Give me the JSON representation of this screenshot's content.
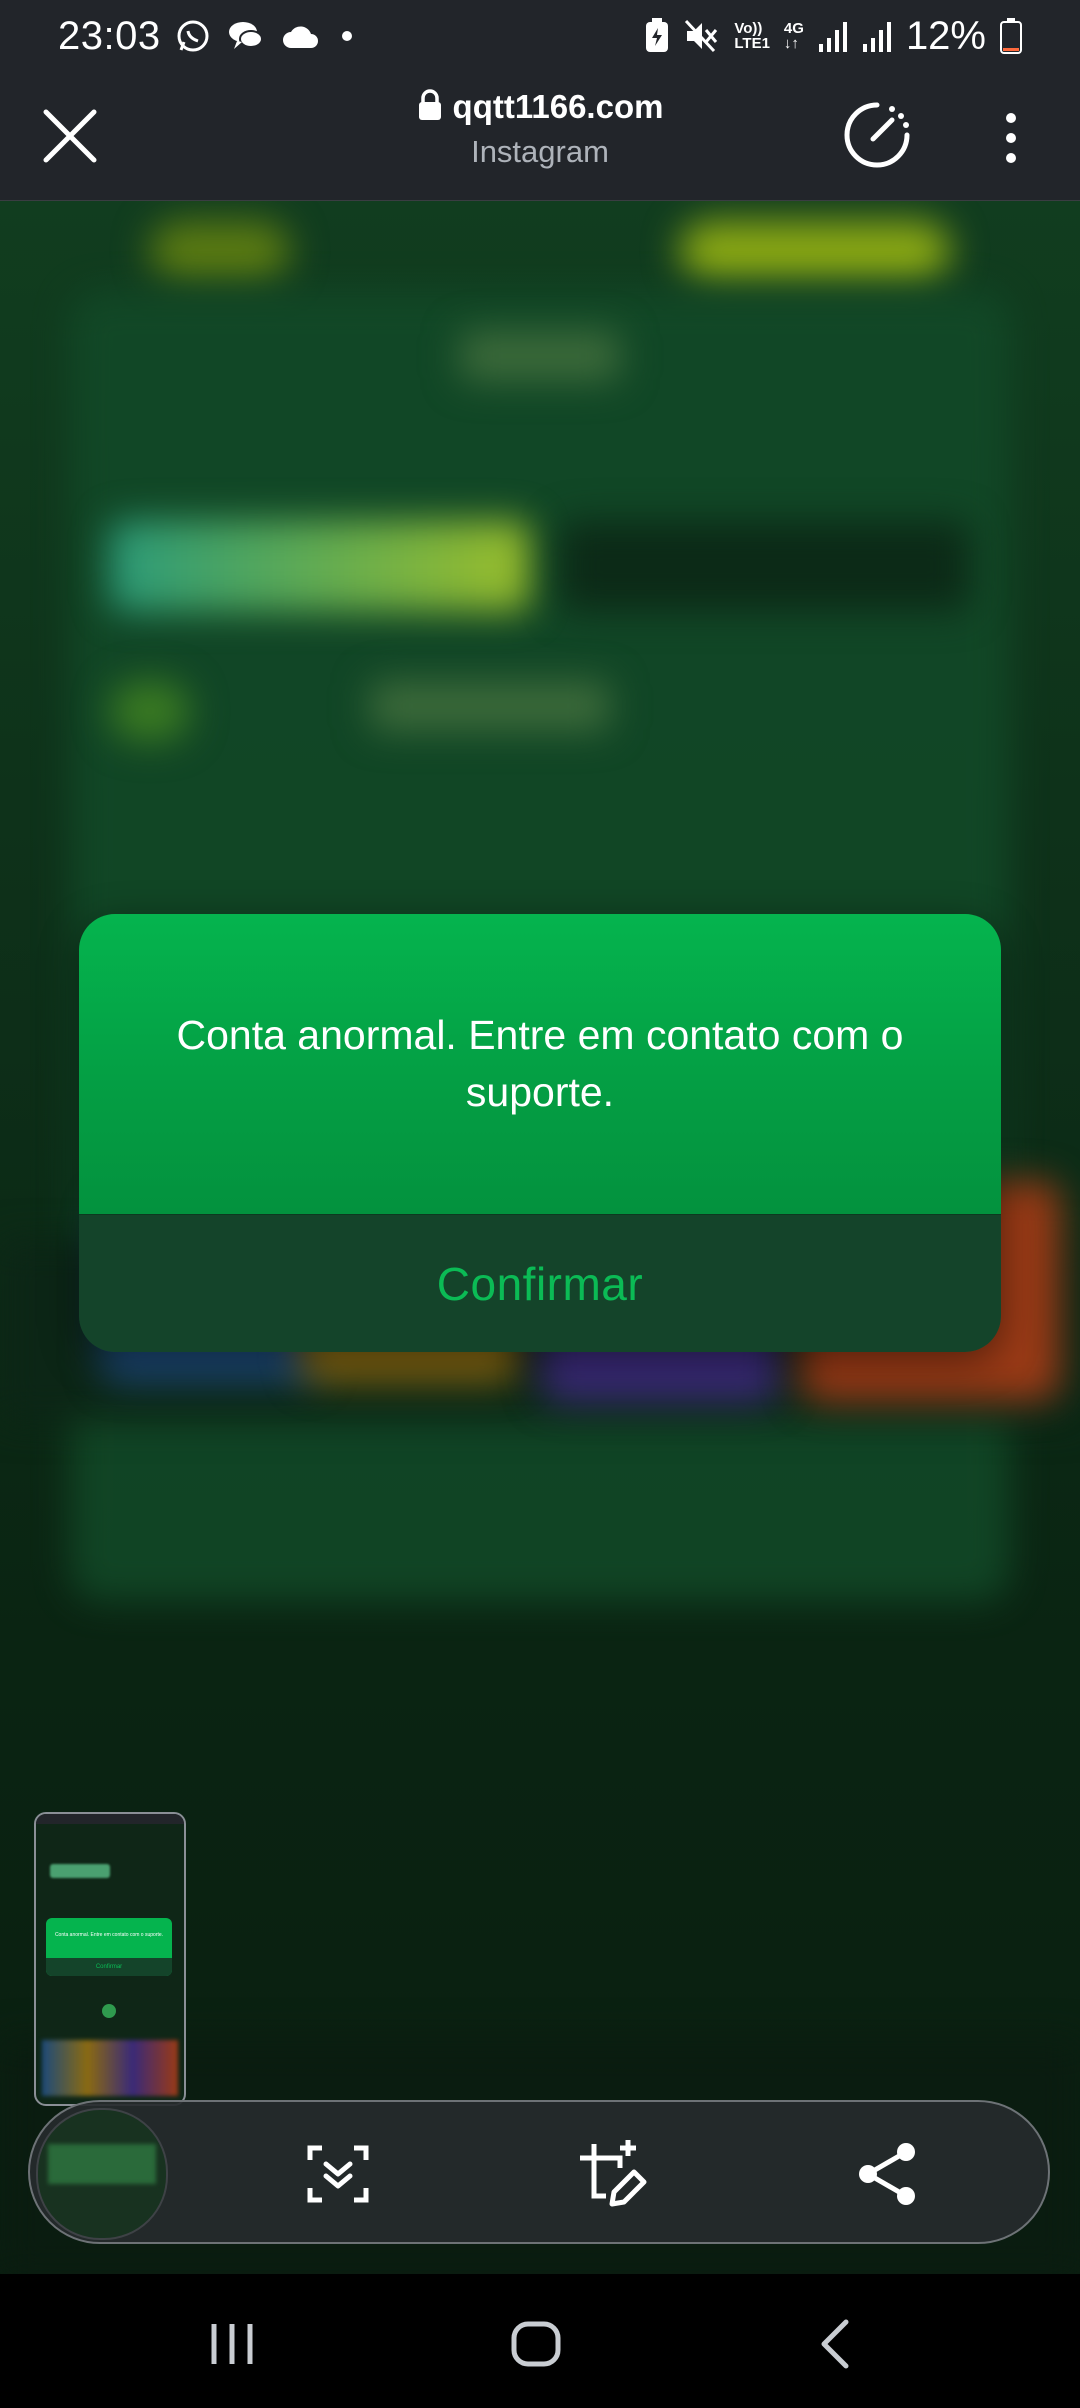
{
  "status_bar": {
    "time": "23:03",
    "left_icons": [
      "whatsapp-icon",
      "chat-bubbles-icon",
      "cloud-icon",
      "dot-icon"
    ],
    "right_icons": [
      "battery-saver-icon",
      "mute-icon",
      "volte-icon",
      "signal-icon",
      "signal-icon"
    ],
    "volte_top": "Vo))",
    "volte_bottom": "LTE1",
    "net_type": "4G",
    "battery": "12%",
    "battery_level": 0.12
  },
  "browser": {
    "url": "qqtt1166.com",
    "subtitle": "Instagram",
    "icons": [
      "close-icon",
      "lock-icon",
      "speed-gauge-icon",
      "more-vert-icon"
    ]
  },
  "dialog": {
    "message": "Conta anormal. Entre em contato com o suporte.",
    "confirm_label": "Confirmar"
  },
  "screenshot_toolbar": {
    "icons": [
      "scroll-capture-icon",
      "edit-crop-icon",
      "share-icon"
    ]
  },
  "thumbnail": {
    "message": "Conta anormal. Entre em contato com o suporte.",
    "confirm_label": "Confirmar"
  },
  "nav_bar": {
    "icons": [
      "recents-icon",
      "home-icon",
      "back-icon"
    ]
  },
  "colors": {
    "dialog_green": "#05b44e",
    "confirm_text": "#0bbb55",
    "toolbar_bg": "#22252a"
  }
}
